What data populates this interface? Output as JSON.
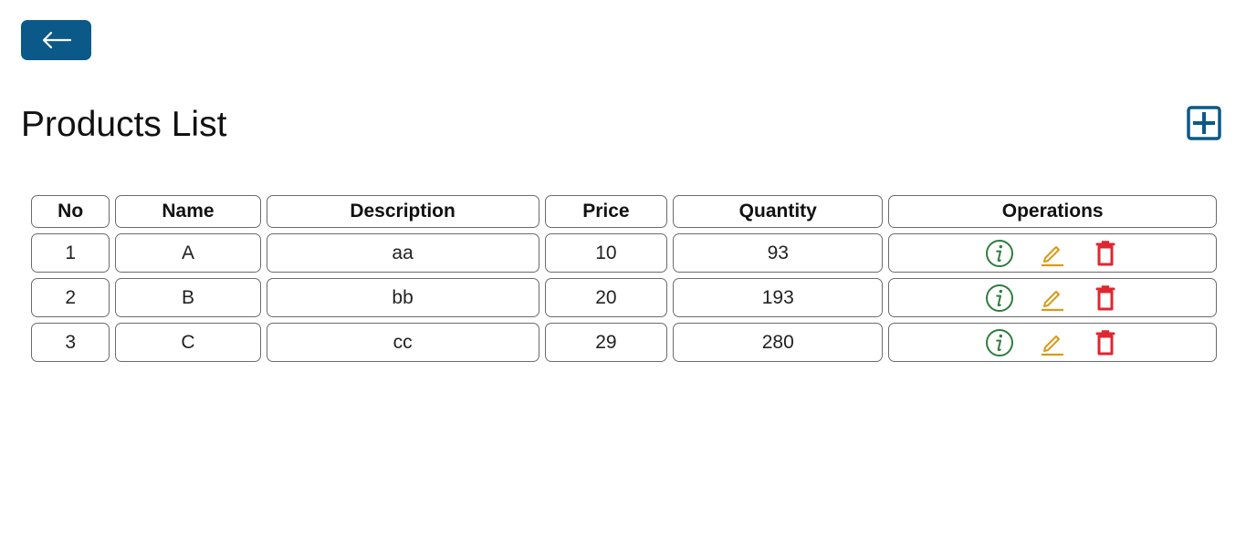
{
  "header": {
    "back_icon": "arrow-left-icon",
    "title": "Products List",
    "add_icon": "plus-square-icon"
  },
  "colors": {
    "primary": "#0b5989",
    "info": "#2e7d3e",
    "edit": "#d89a1a",
    "delete": "#e0262f"
  },
  "table": {
    "columns": [
      "No",
      "Name",
      "Description",
      "Price",
      "Quantity",
      "Operations"
    ],
    "rows": [
      {
        "no": "1",
        "name": "A",
        "description": "aa",
        "price": "10",
        "quantity": "93"
      },
      {
        "no": "2",
        "name": "B",
        "description": "bb",
        "price": "20",
        "quantity": "193"
      },
      {
        "no": "3",
        "name": "C",
        "description": "cc",
        "price": "29",
        "quantity": "280"
      }
    ],
    "operation_icons": [
      "info-icon",
      "pencil-icon",
      "trash-icon"
    ]
  }
}
